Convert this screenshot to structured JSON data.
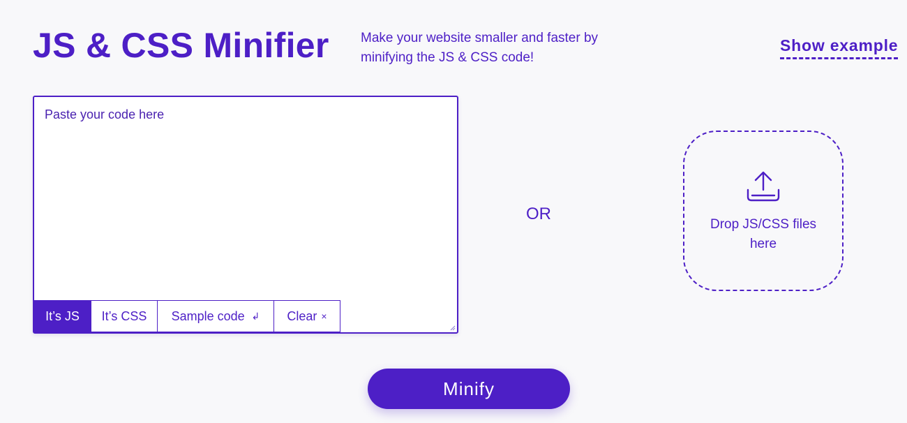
{
  "header": {
    "title": "JS & CSS Minifier",
    "tagline": "Make your website smaller and faster by minifying the JS & CSS code!",
    "show_example_label": "Show example"
  },
  "editor": {
    "placeholder": "Paste your code here",
    "value": "",
    "toolbar": {
      "js_label": "It’s JS",
      "css_label": "It’s CSS",
      "sample_label": "Sample code",
      "sample_glyph": "↲",
      "clear_label": "Clear",
      "clear_glyph": "×",
      "active": "js"
    }
  },
  "separator": "OR",
  "dropzone": {
    "icon": "upload-icon",
    "label": "Drop JS/CSS files here"
  },
  "actions": {
    "minify_label": "Minify"
  },
  "colors": {
    "accent": "#4d1fc6",
    "background": "#f8f8fa",
    "surface": "#ffffff"
  }
}
